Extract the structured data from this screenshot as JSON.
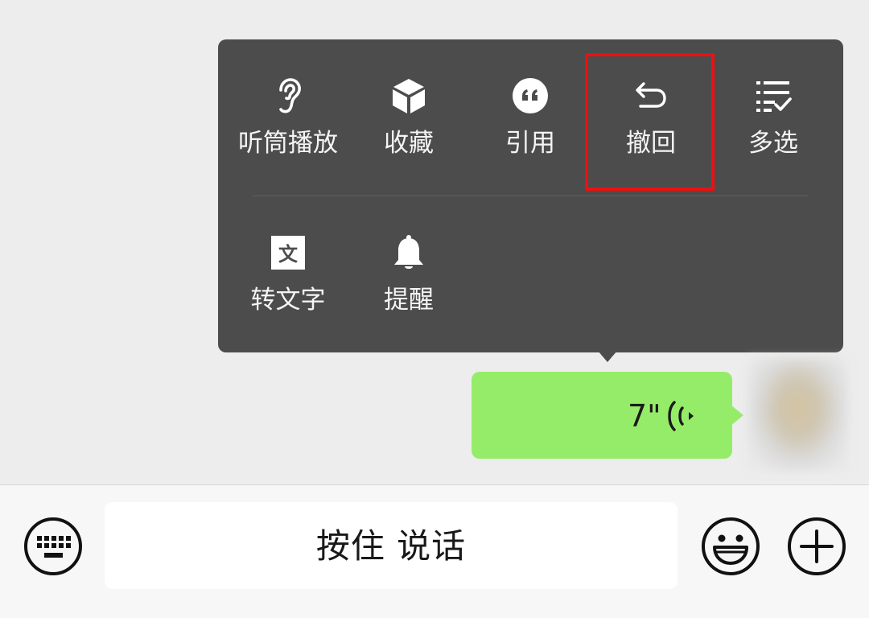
{
  "menu": {
    "items": [
      {
        "label": "听筒播放",
        "icon": "ear-icon"
      },
      {
        "label": "收藏",
        "icon": "cube-icon"
      },
      {
        "label": "引用",
        "icon": "quote-icon"
      },
      {
        "label": "撤回",
        "icon": "undo-icon"
      },
      {
        "label": "多选",
        "icon": "multi-select-icon"
      },
      {
        "label": "转文字",
        "icon": "text-convert-icon"
      },
      {
        "label": "提醒",
        "icon": "bell-icon"
      }
    ],
    "highlighted": "撤回",
    "highlight_color": "#f20e0e"
  },
  "voice_message": {
    "duration": "7\"",
    "bubble_color": "#95ec69"
  },
  "input_bar": {
    "hold_to_talk": "按住 说话",
    "keyboard_icon": "keyboard-icon",
    "emoji_icon": "emoji-icon",
    "plus_icon": "plus-icon"
  }
}
